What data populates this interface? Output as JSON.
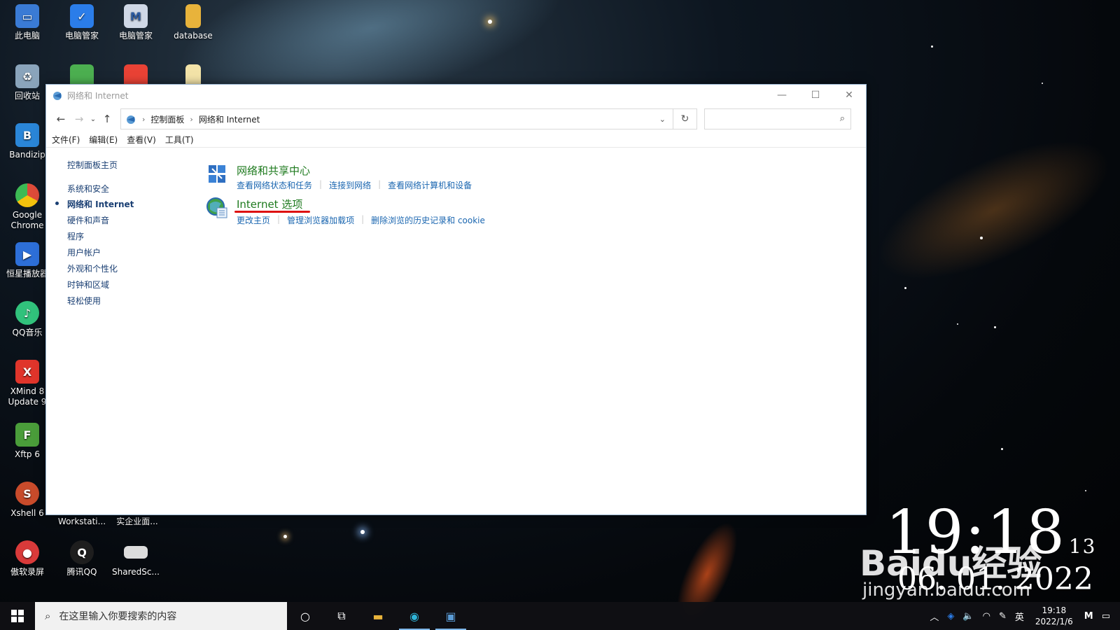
{
  "desktop": {
    "icons": [
      {
        "label": "此电脑",
        "icon": "computer-icon",
        "color": "#3a7bd5"
      },
      {
        "label": "电脑管家",
        "icon": "shield-icon",
        "color": "#2b7de9"
      },
      {
        "label": "电脑管家",
        "icon": "chart-icon",
        "color": "#cfd8e6"
      },
      {
        "label": "database",
        "icon": "folder-icon",
        "color": "#e8b33b"
      },
      {
        "label": "回收站",
        "icon": "recycle-bin-icon",
        "color": "#8aa4bb"
      },
      {
        "label": "Bandizip",
        "icon": "bandizip-icon",
        "color": "#2a86d8"
      },
      {
        "label": "Google Chrome",
        "icon": "chrome-icon",
        "color": "#dd4b39"
      },
      {
        "label": "恒星播放器",
        "icon": "player-icon",
        "color": "#2d6fd8"
      },
      {
        "label": "QQ音乐",
        "icon": "qq-music-icon",
        "color": "#31c27c"
      },
      {
        "label": "XMind 8 Update 9",
        "icon": "xmind-icon",
        "color": "#e0352b"
      },
      {
        "label": "Xftp 6",
        "icon": "xftp-icon",
        "color": "#4a9d3a"
      },
      {
        "label": "Xshell 6",
        "icon": "xshell-icon",
        "color": "#c84b2b"
      },
      {
        "label": "傲软录屏",
        "icon": "screen-recorder-icon",
        "color": "#d93a3a"
      },
      {
        "label": "腾讯QQ",
        "icon": "qq-icon",
        "color": "#1e1e1e"
      },
      {
        "label": "SharedSc...",
        "icon": "shared-icon",
        "color": "#dcdcdc"
      },
      {
        "label": "Workstati...",
        "icon": "workstation-icon",
        "color": "#888"
      },
      {
        "label": "实企业面...",
        "icon": "document-icon",
        "color": "#888"
      }
    ]
  },
  "window": {
    "title": "网络和 Internet",
    "controls": {
      "minimize": "—",
      "maximize": "☐",
      "close": "✕"
    },
    "address": {
      "crumbs": [
        "控制面板",
        "网络和 Internet"
      ],
      "search_placeholder": ""
    },
    "menu": [
      "文件(F)",
      "编辑(E)",
      "查看(V)",
      "工具(T)"
    ],
    "nav": {
      "home": "控制面板主页",
      "items": [
        "系统和安全",
        "网络和 Internet",
        "硬件和声音",
        "程序",
        "用户帐户",
        "外观和个性化",
        "时钟和区域",
        "轻松使用"
      ],
      "active_index": 1
    },
    "categories": [
      {
        "title": "网络和共享中心",
        "icon": "network-sharing-icon",
        "links": [
          "查看网络状态和任务",
          "连接到网络",
          "查看网络计算机和设备"
        ]
      },
      {
        "title": "Internet 选项",
        "icon": "internet-options-icon",
        "links": [
          "更改主页",
          "管理浏览器加载项",
          "删除浏览的历史记录和 cookie"
        ],
        "highlighted": true
      }
    ]
  },
  "overlay": {
    "clock_time": "19:18",
    "clock_seconds": "13",
    "clock_date": "06. 01. 2022",
    "watermark": "Baidu经验",
    "watermark_url": "jingyan.baidu.com"
  },
  "taskbar": {
    "search_placeholder": "在这里输入你要搜索的内容",
    "tray_ime": "英",
    "tray_time": "19:18",
    "tray_date": "2022/1/6"
  },
  "colors": {
    "link": "#1a66b0",
    "category_title": "#1e7a1e",
    "nav_text": "#1a3f73",
    "annotation": "#dd1111"
  }
}
